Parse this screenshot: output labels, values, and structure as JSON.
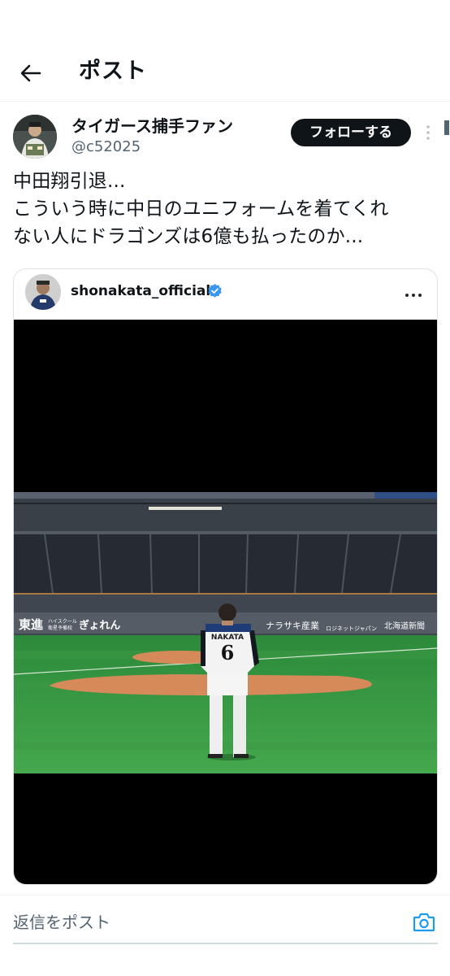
{
  "header": {
    "title": "ポスト",
    "back_icon": "arrow-left-icon"
  },
  "post": {
    "author": {
      "display_name": "タイガース捕手ファン",
      "handle": "@c52025"
    },
    "follow_label": "フォローする",
    "text_lines": [
      "中田翔引退...",
      "こういう時に中日のユニフォームを着てくれ",
      "ない人にドラゴンズは6億も払ったのか..."
    ]
  },
  "embed": {
    "username": "shonakata_official",
    "verified": true,
    "photo": {
      "banners": [
        "東進",
        "ハイスクール",
        "衛星予備校",
        "ぎょれん",
        "ナラサキ産業",
        "ロジネットジャパン",
        "北海道新聞"
      ],
      "jersey_name": "NAKATA",
      "jersey_number": "6"
    }
  },
  "composer": {
    "placeholder": "返信をポスト",
    "camera_icon": "camera-icon"
  },
  "colors": {
    "accent": "#1d9bf0",
    "text": "#0f1419",
    "muted": "#536471",
    "button": "#0f1419"
  }
}
